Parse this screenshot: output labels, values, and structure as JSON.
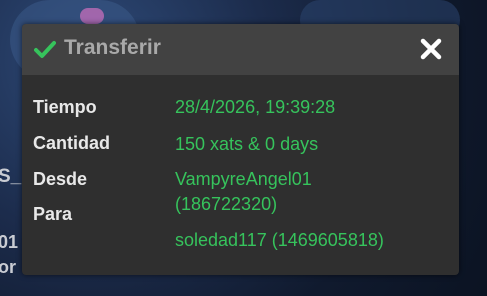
{
  "background": {
    "fragments": [
      "S_",
      "01",
      "or"
    ]
  },
  "dialog": {
    "title": "Transferir",
    "accent_color": "#36c35c",
    "icons": {
      "title_icon": "checkmark-icon",
      "close_icon": "close-icon"
    }
  },
  "details": {
    "time_label": "Tiempo",
    "time_value": "28/4/2026, 19:39:28",
    "amount_label": "Cantidad",
    "amount_value": "150 xats & 0 days",
    "from_label": "Desde",
    "from_value_line1": "VampyreAngel01",
    "from_value_line2": "(186722320)",
    "to_label": "Para",
    "to_value": "soledad117 (1469605818)"
  }
}
